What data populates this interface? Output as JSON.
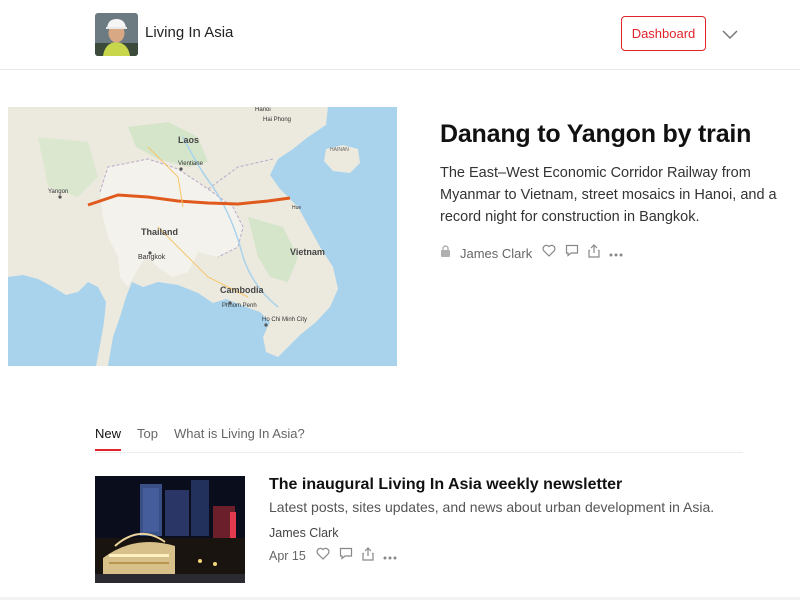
{
  "header": {
    "brand": "Living In Asia",
    "dashboard_label": "Dashboard",
    "accent_color": "#e0242b"
  },
  "hero": {
    "title": "Danang to Yangon by train",
    "subtitle": "The East–West Economic Corridor Railway from Myanmar to Vietnam, street mosaics in Hanoi, and a record night for construction in Bangkok.",
    "author": "James Clark",
    "map_labels": {
      "laos": "Laos",
      "thailand": "Thailand",
      "vietnam": "Vietnam",
      "cambodia": "Cambodia",
      "bangkok": "Bangkok",
      "yangon": "Yangon",
      "hanoi": "Hanoi",
      "hai_phong": "Hai Phong",
      "vientiane": "Vientiane",
      "phnom_penh": "Phnom Penh",
      "ho_chi_minh": "Ho Chi Minh City",
      "hainan": "HAINAN",
      "hue": "Hue"
    }
  },
  "tabs": [
    {
      "label": "New",
      "active": true
    },
    {
      "label": "Top",
      "active": false
    },
    {
      "label": "What is Living In Asia?",
      "active": false
    }
  ],
  "post": {
    "title": "The inaugural Living In Asia weekly newsletter",
    "subtitle": "Latest posts, sites updates, and news about urban development in Asia.",
    "author": "James Clark",
    "date": "Apr 15"
  },
  "icons": {
    "lock": "lock-icon",
    "heart": "heart-icon",
    "comment": "comment-icon",
    "share": "share-icon",
    "more": "more-icon",
    "chevron": "chevron-down-icon"
  }
}
